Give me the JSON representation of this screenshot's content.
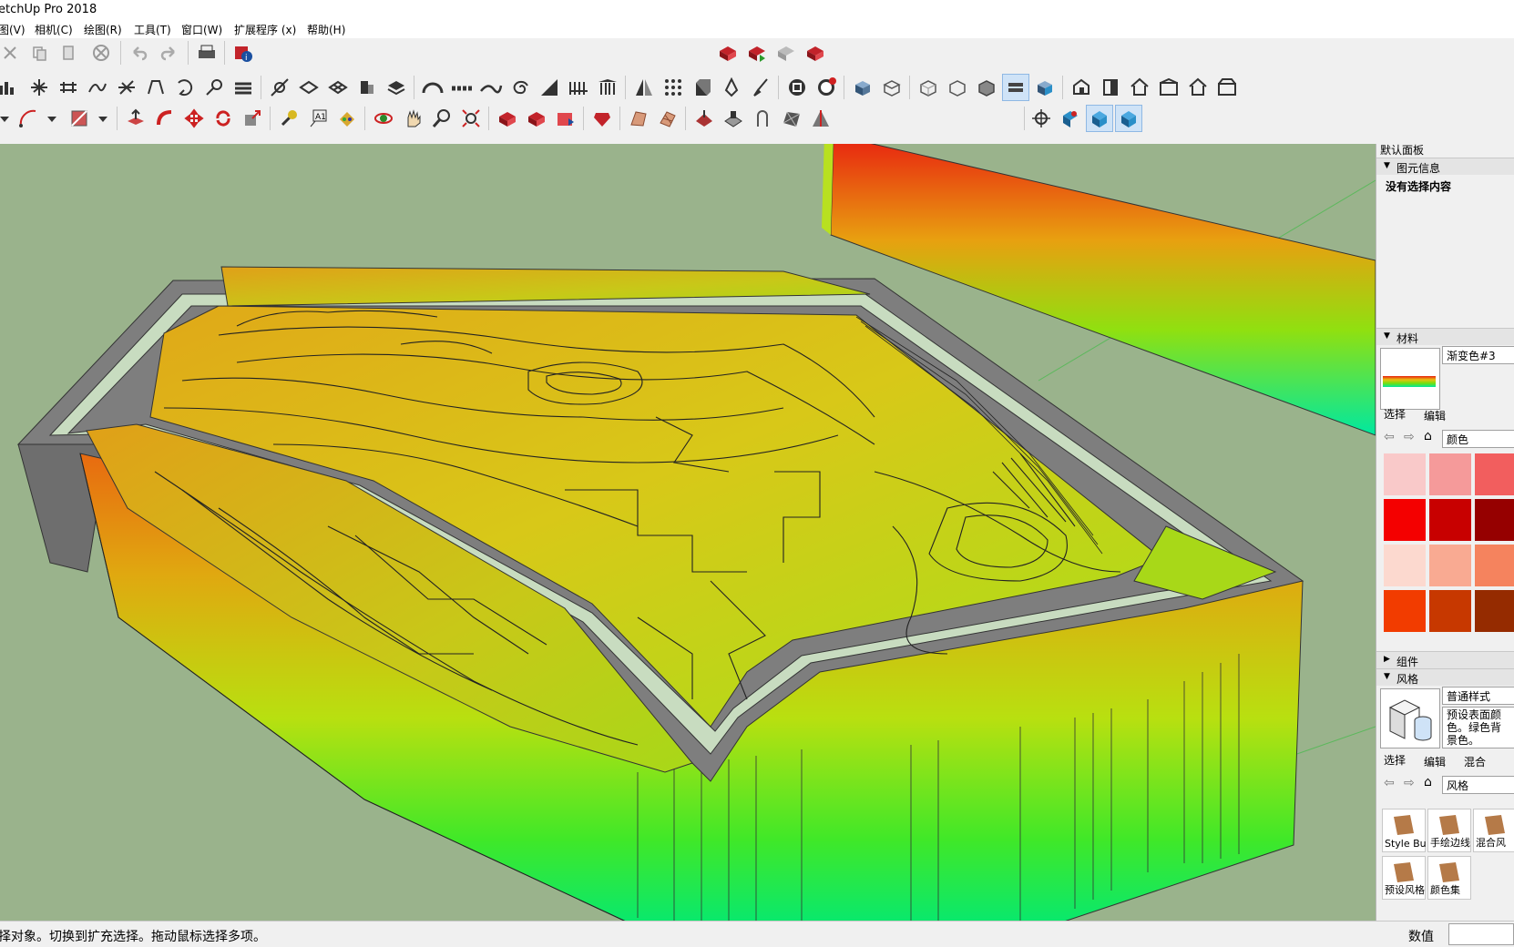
{
  "window": {
    "title": "etchUp Pro 2018"
  },
  "menu": [
    {
      "label": "图(V)"
    },
    {
      "label": "相机(C)"
    },
    {
      "label": "绘图(R)"
    },
    {
      "label": "工具(T)"
    },
    {
      "label": "窗口(W)"
    },
    {
      "label": "扩展程序 (x)"
    },
    {
      "label": "帮助(H)"
    }
  ],
  "tray": {
    "title": "默认面板",
    "entity_info": {
      "header": "图元信息",
      "empty_text": "没有选择内容"
    },
    "materials": {
      "header": "材料",
      "current_name": "渐变色#3",
      "tab_select": "选择",
      "tab_edit": "编辑",
      "category": "颜色",
      "swatch_colors": [
        "#f9c9c9",
        "#f59a9a",
        "#f25e5e",
        "#f40000",
        "#c80000",
        "#960000",
        "#fcd9cf",
        "#f9aa92",
        "#f5835e",
        "#f23c00",
        "#c73800",
        "#952b00"
      ]
    },
    "components": {
      "header": "组件"
    },
    "styles": {
      "header": "风格",
      "current_name": "普通样式",
      "description": "预设表面颜色。绿色背景色。",
      "tab_select": "选择",
      "tab_edit": "编辑",
      "tab_mix": "混合",
      "category": "风格",
      "items": [
        {
          "label": "Style Buil"
        },
        {
          "label": "手绘边线"
        },
        {
          "label": "混合风"
        },
        {
          "label": "预设风格"
        },
        {
          "label": "颜色集"
        }
      ]
    }
  },
  "status": {
    "message": "择对象。切换到扩充选择。拖动鼠标选择多项。",
    "value_label": "数值",
    "value": ""
  },
  "colors": {
    "viewport_bg": "#9ab38c",
    "road": "#7e7e7e",
    "sidewalk": "#c8dcc0"
  }
}
